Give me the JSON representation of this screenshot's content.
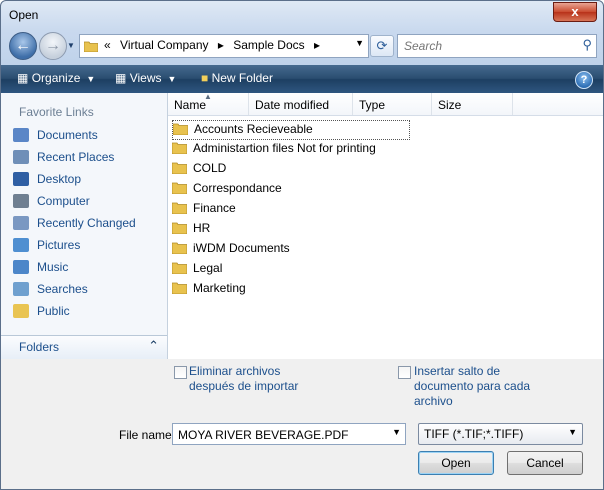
{
  "window": {
    "title": "Open",
    "close_label": "x"
  },
  "nav": {
    "breadcrumb": [
      "«",
      "Virtual Company",
      "▸",
      "Sample Docs",
      "▸"
    ],
    "search_placeholder": "Search"
  },
  "toolbar": {
    "organize": "Organize",
    "views": "Views",
    "new_folder": "New Folder",
    "help": "?"
  },
  "sidebar": {
    "title": "Favorite Links",
    "items": [
      {
        "label": "Documents",
        "icon": "documents-icon",
        "color": "#5a86c7"
      },
      {
        "label": "Recent Places",
        "icon": "recent-places-icon",
        "color": "#6f8fb8"
      },
      {
        "label": "Desktop",
        "icon": "desktop-icon",
        "color": "#2f5fa4"
      },
      {
        "label": "Computer",
        "icon": "computer-icon",
        "color": "#6f7f91"
      },
      {
        "label": "Recently Changed",
        "icon": "recently-changed-icon",
        "color": "#7a98c2"
      },
      {
        "label": "Pictures",
        "icon": "pictures-icon",
        "color": "#4f8fd1"
      },
      {
        "label": "Music",
        "icon": "music-icon",
        "color": "#4c86c9"
      },
      {
        "label": "Searches",
        "icon": "searches-icon",
        "color": "#6fa0cf"
      },
      {
        "label": "Public",
        "icon": "public-folder-icon",
        "color": "#e9c452"
      }
    ],
    "folders_label": "Folders"
  },
  "filelist": {
    "columns": [
      "Name",
      "Date modified",
      "Type",
      "Size"
    ],
    "rows": [
      "Accounts Recieveable",
      "Administartion files Not for printing",
      "COLD",
      "Correspondance",
      "Finance",
      "HR",
      "iWDM Documents",
      "Legal",
      "Marketing"
    ],
    "selected_index": 0
  },
  "options": {
    "delete_after_import": "Eliminar archivos\ndespués de importar",
    "insert_break": "Insertar salto de\ndocumento para cada\narchivo"
  },
  "footer": {
    "file_name_label": "File name:",
    "file_name_value": "MOYA RIVER BEVERAGE.PDF",
    "file_type": "TIFF (*.TIF;*.TIFF)",
    "open": "Open",
    "cancel": "Cancel"
  },
  "colors": {
    "folder": "#e8c24e",
    "link": "#1c4f8c",
    "toolbar": "#2a4d70"
  }
}
